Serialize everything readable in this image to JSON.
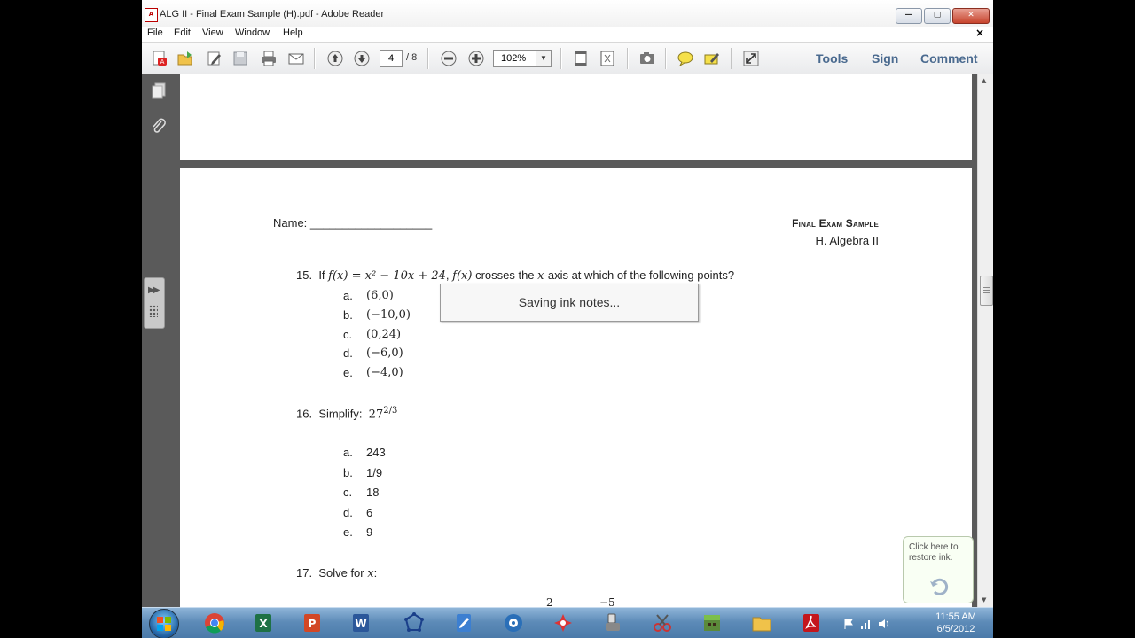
{
  "window": {
    "title": "ALG II - Final Exam Sample (H).pdf - Adobe Reader",
    "icon_name": "pdf-icon",
    "controls": [
      "minimize-icon",
      "maximize-icon",
      "close-icon"
    ],
    "close_label": "✕",
    "min_label": "—",
    "max_label": "▢"
  },
  "menu": {
    "items": [
      "File",
      "Edit",
      "View",
      "Window",
      "Help"
    ],
    "close_doc": "×"
  },
  "toolbar": {
    "current_page": "4",
    "page_count": "/ 8",
    "zoom": "102%",
    "links": {
      "tools": "Tools",
      "sign": "Sign",
      "comment": "Comment"
    }
  },
  "document": {
    "header": {
      "name_label": "Name: ___________________",
      "title": "Final Exam Sample",
      "subtitle": "H. Algebra II"
    },
    "q15": {
      "number": "15.",
      "prefix": "If",
      "func": "f(x) = x² − 10x + 24",
      "sep": ",",
      "func2": "f(x)",
      "text_a": "crosses the",
      "var": "x",
      "text_b": "-axis at which of the following points?",
      "options": [
        {
          "letter": "a.",
          "value": "(6,0)"
        },
        {
          "letter": "b.",
          "value": "(−10,0)"
        },
        {
          "letter": "c.",
          "value": "(0,24)"
        },
        {
          "letter": "d.",
          "value": "(−6,0)"
        },
        {
          "letter": "e.",
          "value": "(−4,0)"
        }
      ]
    },
    "q16": {
      "number": "16.",
      "prompt": "Simplify:",
      "base": "27",
      "exponent": "2/3",
      "options": [
        {
          "letter": "a.",
          "value": "243"
        },
        {
          "letter": "b.",
          "value": "1/9"
        },
        {
          "letter": "c.",
          "value": "18"
        },
        {
          "letter": "d.",
          "value": "6"
        },
        {
          "letter": "e.",
          "value": "9"
        }
      ]
    },
    "q17": {
      "number": "17.",
      "prompt": "Solve for",
      "var": "x",
      "colon": ":",
      "partial_a": "2",
      "partial_b": "−5"
    }
  },
  "toast": {
    "message": "Saving ink notes..."
  },
  "restore_ink": {
    "message": "Click here to restore ink.",
    "icon_name": "undo-icon"
  },
  "taskbar": {
    "apps": [
      "chrome-icon",
      "excel-icon",
      "powerpoint-icon",
      "word-icon",
      "network-icon",
      "notepad-icon",
      "media-icon",
      "snip-icon",
      "tablet-icon",
      "scissors-icon",
      "minecraft-icon",
      "folder-icon",
      "acrobat-icon"
    ],
    "time": "11:55 AM",
    "date": "6/5/2012",
    "colors": {
      "accent": "#4a79a8"
    }
  }
}
